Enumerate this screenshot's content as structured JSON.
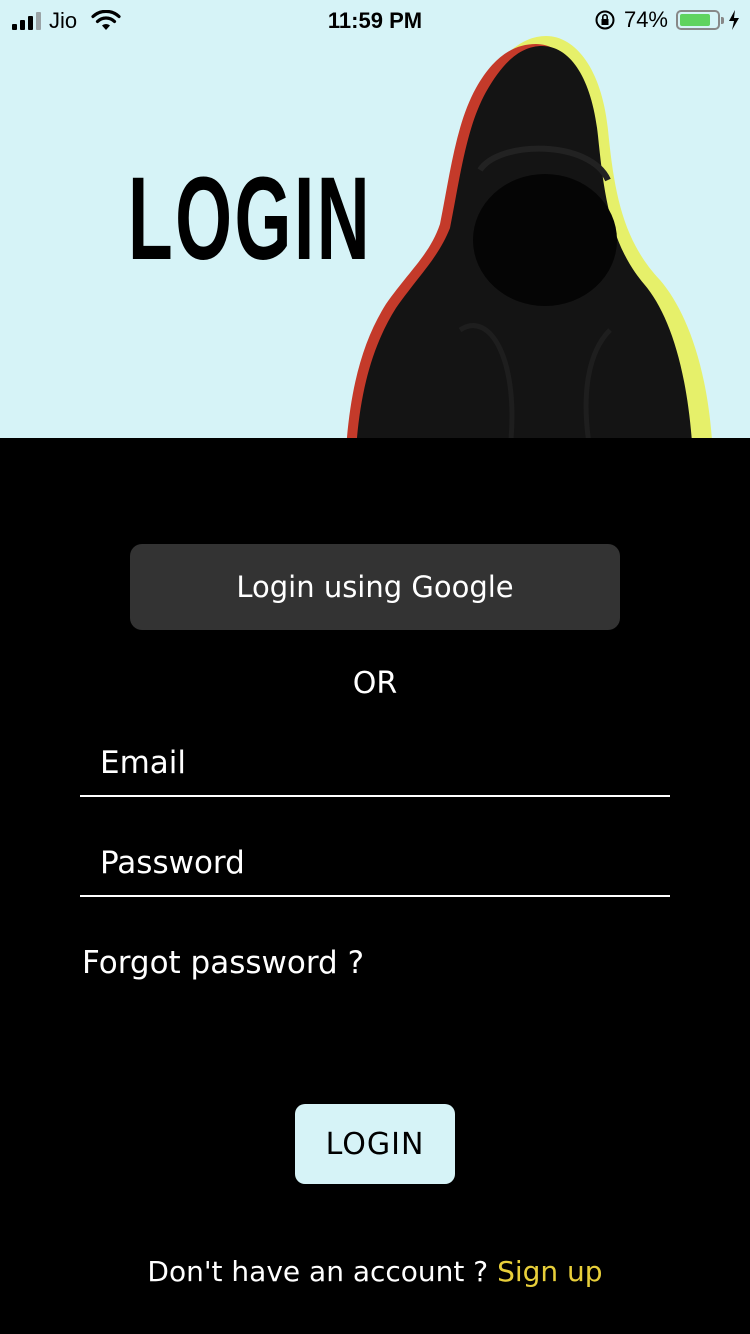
{
  "status_bar": {
    "carrier": "Jio",
    "time": "11:59 PM",
    "battery_percent": "74%",
    "battery_level": 0.74
  },
  "hero": {
    "title": "LOGIN",
    "background_color": "#d6f3f7"
  },
  "auth": {
    "google_button_label": "Login using Google",
    "or_label": "OR",
    "email_placeholder": "Email",
    "password_placeholder": "Password",
    "forgot_password_label": "Forgot password ?",
    "login_button_label": "LOGIN",
    "signup_prompt": "Don't have an account ?",
    "signup_link_label": "Sign up"
  },
  "colors": {
    "accent": "#e8cf3a",
    "button_dark": "#333333",
    "background": "#000000"
  }
}
